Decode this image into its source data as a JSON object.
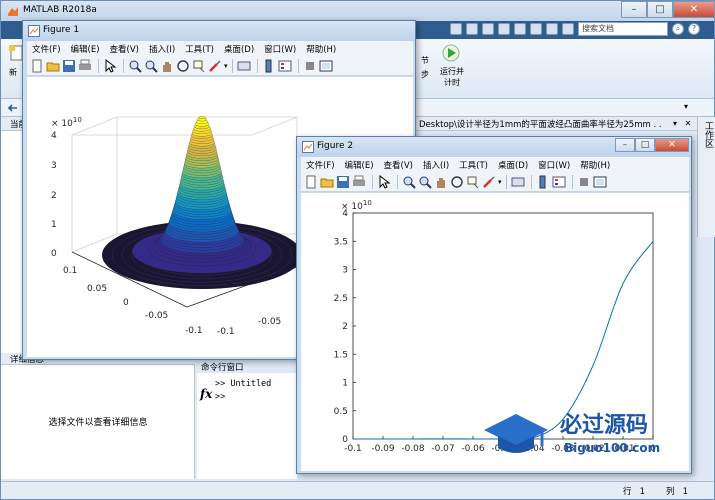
{
  "matlab": {
    "title": "MATLAB R2018a",
    "search_placeholder": "搜索文档",
    "help_glyph": "?",
    "ribbon": {
      "new_label": "新",
      "run_section_label": "节",
      "run_time_label_1": "运行并",
      "run_time_label_2": "计时",
      "step_label": "步"
    },
    "current_folder_label": "当前",
    "address_path": "Desktop\\设计半径为1mm的平面波经凸面曲率半径为25mm . . .",
    "workspace_label": "工作区",
    "details_label": "详细信息",
    "details_placeholder": "选择文件以查看详细信息",
    "command_window_label": "命令行窗口",
    "command_lines": [
      ">> Untitled",
      ">>"
    ],
    "fx_glyph": "fx",
    "status": {
      "row_label": "行",
      "row_value": "1",
      "col_label": "列",
      "col_value": "1"
    }
  },
  "figure1": {
    "title": "Figure 1",
    "menus": [
      "文件(F)",
      "编辑(E)",
      "查看(V)",
      "插入(I)",
      "工具(T)",
      "桌面(D)",
      "窗口(W)",
      "帮助(H)"
    ],
    "exponent": "× 10",
    "exponent_power": "10",
    "z_ticks": [
      "0",
      "1",
      "2",
      "3",
      "4"
    ],
    "x_ticks": [
      "0.1",
      "0.05",
      "0",
      "-0.05",
      "-0.1"
    ],
    "y_ticks": [
      "-0.1",
      "-0.05"
    ]
  },
  "figure2": {
    "title": "Figure 2",
    "menus": [
      "文件(F)",
      "编辑(E)",
      "查看(V)",
      "插入(I)",
      "工具(T)",
      "桌面(D)",
      "窗口(W)",
      "帮助(H)"
    ],
    "exponent": "× 10",
    "exponent_power": "10"
  },
  "chart_data": [
    {
      "type": "line",
      "x": [
        -0.1,
        -0.09,
        -0.08,
        -0.07,
        -0.06,
        -0.05,
        -0.04,
        -0.03,
        -0.02,
        -0.01,
        0
      ],
      "series": [
        {
          "values": [
            0,
            0.0003,
            0.001,
            0.002,
            0.001,
            0.0,
            0.02,
            0.35,
            1.3,
            2.75,
            3.5
          ]
        }
      ],
      "color": "#0072bd",
      "xlim": [
        -0.1,
        0
      ],
      "ylim": [
        0,
        4
      ],
      "y_multiplier": "× 10^10",
      "x_ticks": [
        "-0.1",
        "-0.09",
        "-0.08",
        "-0.07",
        "-0.06",
        "-0.05",
        "-0.04",
        "-0.03",
        "-0.02",
        "-0.01",
        "0"
      ],
      "y_ticks": [
        "0",
        "0.5",
        "1",
        "1.5",
        "2",
        "2.5",
        "3",
        "3.5",
        "4"
      ],
      "grid": false
    }
  ],
  "watermark": {
    "cn": "必过源码",
    "en": "Biguo100.com"
  }
}
